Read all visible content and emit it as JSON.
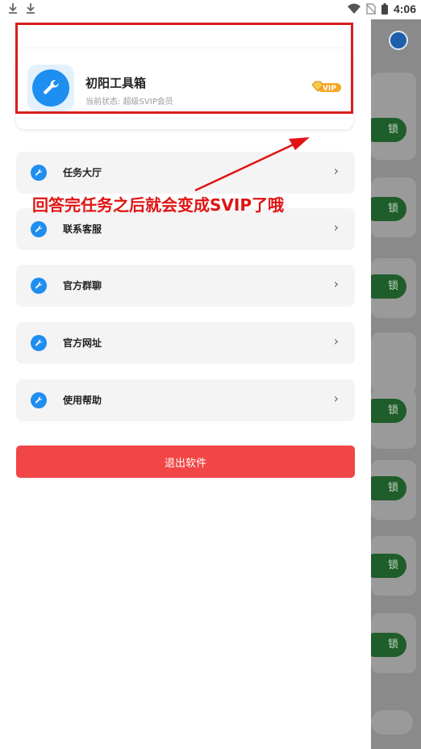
{
  "status_bar": {
    "time": "4:06",
    "left_icons": [
      "download-icon",
      "download-icon"
    ],
    "right_icons": [
      "wifi-icon",
      "no-sim-icon",
      "battery-icon"
    ]
  },
  "profile": {
    "app_name": "初阳工具箱",
    "status_label": "当前状态:",
    "status_value": "超级SVIP会员",
    "badge": "VIP"
  },
  "menu": {
    "items": [
      {
        "label": "任务大厅",
        "chevron": "›"
      },
      {
        "label": "联系客服",
        "chevron": "›"
      },
      {
        "label": "官方群聊",
        "chevron": "›"
      },
      {
        "label": "官方网址",
        "chevron": "›"
      },
      {
        "label": "使用帮助",
        "chevron": "›"
      }
    ]
  },
  "logout": {
    "label": "退出软件"
  },
  "annotation": {
    "text": "回答完任务之后就会变成SVIP了哦",
    "color": "#e01414"
  },
  "background_app": {
    "button_label": "锁"
  },
  "colors": {
    "accent": "#1e8ef0",
    "logout": "#f24545",
    "highlight": "#d81e1e",
    "vip": "#f5a623"
  }
}
